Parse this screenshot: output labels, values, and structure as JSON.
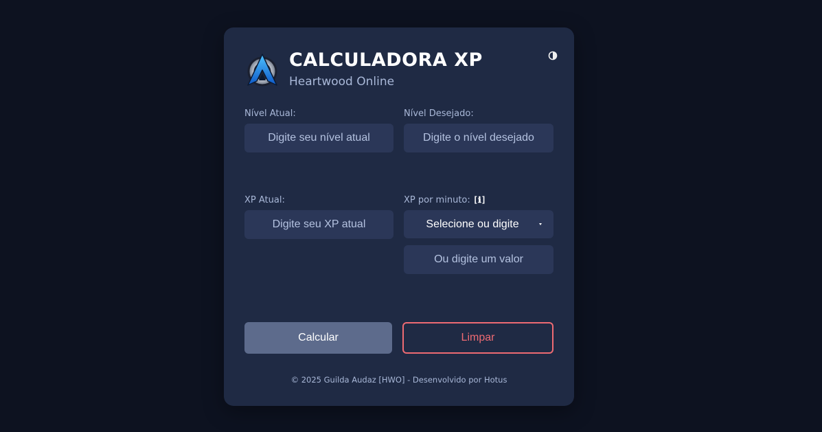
{
  "header": {
    "title": "CALCULADORA XP",
    "subtitle": "Heartwood Online",
    "logo_icon": "guild-a-emblem-icon",
    "theme_toggle_icon": "contrast-half-circle-icon"
  },
  "form": {
    "current_level": {
      "label": "Nível Atual:",
      "placeholder": "Digite seu nível atual",
      "value": ""
    },
    "desired_level": {
      "label": "Nível Desejado:",
      "placeholder": "Digite o nível desejado",
      "value": ""
    },
    "current_xp": {
      "label": "XP Atual:",
      "placeholder": "Digite seu XP atual",
      "value": ""
    },
    "xp_per_minute": {
      "label": "XP por minuto:",
      "info_text": "[ℹ]",
      "select_value": "Selecione ou digite",
      "custom_placeholder": "Ou digite um valor",
      "custom_value": ""
    }
  },
  "actions": {
    "calculate_label": "Calcular",
    "clear_label": "Limpar"
  },
  "footer": {
    "text": "© 2025 Guilda Audaz [HWO] - Desenvolvido por Hotus"
  },
  "colors": {
    "page_background": "#0d1220",
    "card_background": "#1f2a44",
    "input_background": "#2b3758",
    "label_text": "#a9b8d8",
    "calculate_button": "#5d6b8c",
    "clear_accent": "#ef6b73"
  }
}
